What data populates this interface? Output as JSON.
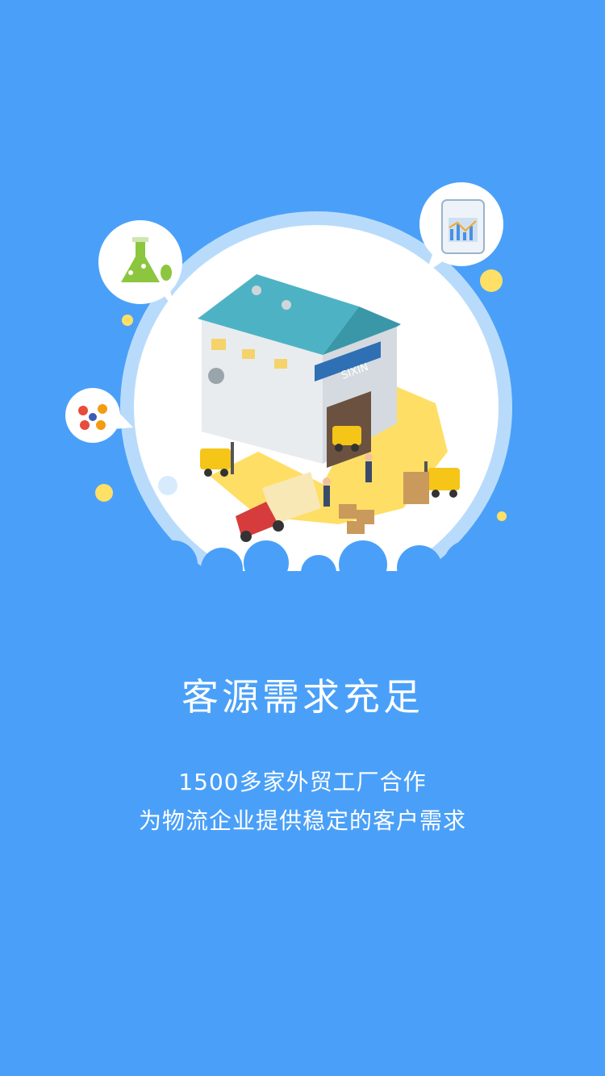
{
  "onboarding": {
    "title": "客源需求充足",
    "description_line1": "1500多家外贸工厂合作",
    "description_line2": "为物流企业提供稳定的客户需求"
  },
  "illustration": {
    "warehouse_sign": "SIXIN",
    "icons": [
      "flask-icon",
      "molecule-icon",
      "phone-chart-icon"
    ]
  },
  "colors": {
    "background": "#4aa0f8",
    "circle_ring": "#b9dbfb",
    "highlight_yellow": "#ffd84a",
    "roof_teal": "#4db3c4"
  }
}
